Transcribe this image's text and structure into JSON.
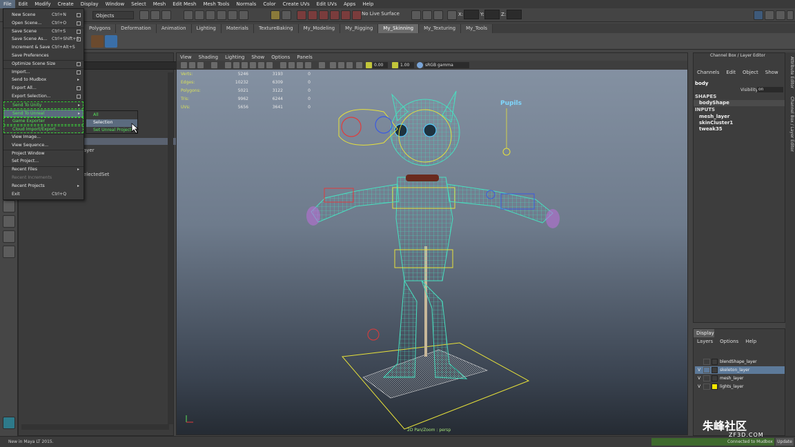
{
  "menubar": [
    "File",
    "Edit",
    "Modify",
    "Create",
    "Display",
    "Window",
    "Select",
    "Mesh",
    "Edit Mesh",
    "Mesh Tools",
    "Normals",
    "Color",
    "Create UVs",
    "Edit UVs",
    "Apps",
    "Help"
  ],
  "statusline": {
    "selection_mode": "Objects",
    "live_surface": "No Live Surface",
    "x_label": "X:",
    "y_label": "Y:",
    "z_label": "Z:"
  },
  "shelf_tabs": [
    "Polygons",
    "Deformation",
    "Animation",
    "Lighting",
    "Materials",
    "TextureBaking",
    "My_Modeling",
    "My_Rigging",
    "My_Skinning",
    "My_Texturing",
    "My_Tools"
  ],
  "shelf_active_tab": "My_Skinning",
  "file_menu": {
    "items": [
      {
        "label": "New Scene",
        "shortcut": "Ctrl+N",
        "option": true
      },
      {
        "label": "Open Scene...",
        "shortcut": "Ctrl+O",
        "option": true
      },
      {
        "label": "Save Scene",
        "shortcut": "Ctrl+S",
        "option": true
      },
      {
        "label": "Save Scene As...",
        "shortcut": "Ctrl+Shift+S",
        "option": true
      },
      {
        "label": "Increment & Save",
        "shortcut": "Ctrl+Alt+S",
        "option": false
      },
      {
        "label": "Save Preferences",
        "shortcut": "",
        "option": false
      },
      {
        "label": "Optimize Scene Size",
        "shortcut": "",
        "option": true
      },
      {
        "label": "Import...",
        "shortcut": "",
        "option": true
      },
      {
        "label": "Send to Mudbox",
        "shortcut": "",
        "submenu": true
      },
      {
        "label": "Export All...",
        "shortcut": "",
        "option": true
      },
      {
        "label": "Export Selection...",
        "shortcut": "",
        "option": true
      },
      {
        "label": "Send To Unity",
        "shortcut": "",
        "submenu": true,
        "green": true
      },
      {
        "label": "Send To Unreal",
        "shortcut": "",
        "submenu": true,
        "green": true,
        "highlight": true
      },
      {
        "label": "Game Exporter",
        "shortcut": "",
        "green": true
      },
      {
        "label": "Cloud Import/Export...",
        "shortcut": "",
        "green": true
      },
      {
        "label": "View Image...",
        "shortcut": ""
      },
      {
        "label": "View Sequence...",
        "shortcut": ""
      },
      {
        "label": "Project Window",
        "shortcut": ""
      },
      {
        "label": "Set Project...",
        "shortcut": ""
      },
      {
        "label": "Recent Files",
        "shortcut": "",
        "submenu": true
      },
      {
        "label": "Recent Increments",
        "shortcut": "",
        "dim": true
      },
      {
        "label": "Recent Projects",
        "shortcut": "",
        "submenu": true
      },
      {
        "label": "Exit",
        "shortcut": "Ctrl+Q"
      }
    ]
  },
  "submenu": [
    "All",
    "Selection",
    "Set Unreal Project"
  ],
  "outliner": {
    "rows": [
      "ayer",
      "electedSet"
    ]
  },
  "viewport": {
    "menu": [
      "View",
      "Shading",
      "Lighting",
      "Show",
      "Options",
      "Panels"
    ],
    "exposure": "0.00",
    "gamma": "1.00",
    "color_space": "sRGB gamma",
    "hud": [
      {
        "label": "Verts:",
        "a": "5246",
        "b": "3193",
        "c": "0"
      },
      {
        "label": "Edges:",
        "a": "10232",
        "b": "6309",
        "c": "0"
      },
      {
        "label": "Polygons:",
        "a": "5021",
        "b": "3122",
        "c": "0"
      },
      {
        "label": "Tris:",
        "a": "9962",
        "b": "6244",
        "c": "0"
      },
      {
        "label": "UVs:",
        "a": "5656",
        "b": "3641",
        "c": "0"
      }
    ],
    "camera_label": "2D Pan/Zoom : persp",
    "annotation": "Pupils"
  },
  "channel_box": {
    "title": "Channel Box / Layer Editor",
    "menu": [
      "Channels",
      "Edit",
      "Object",
      "Show"
    ],
    "node": "body",
    "visibility_label": "Visibility",
    "visibility_value": "on",
    "shapes_header": "SHAPES",
    "shapes": [
      "bodyShape"
    ],
    "inputs_header": "INPUTS",
    "inputs": [
      "mesh_layer",
      "skinCluster1",
      "tweak35"
    ]
  },
  "side_tabs": [
    "Attribute Editor",
    "Channel Box / Layer Editor"
  ],
  "layers": {
    "tab": "Display",
    "menu": [
      "Layers",
      "Options",
      "Help"
    ],
    "rows": [
      {
        "v": "",
        "name": "blendShape_layer",
        "color": "#3d3d3d",
        "selected": false
      },
      {
        "v": "V",
        "name": "skeleton_layer",
        "color": "#3d3d3d",
        "selected": true
      },
      {
        "v": "V",
        "name": "mesh_layer",
        "color": "#3d3d3d",
        "selected": false
      },
      {
        "v": "V",
        "name": "lights_layer",
        "color": "#f2e600",
        "selected": false
      }
    ]
  },
  "helpline": {
    "message": "New in Maya LT 2015.",
    "mudbox_status": "Connected to Mudbox",
    "update": "Update"
  },
  "watermark": {
    "brand": "朱峰社区",
    "site": "ZF3D.COM"
  }
}
